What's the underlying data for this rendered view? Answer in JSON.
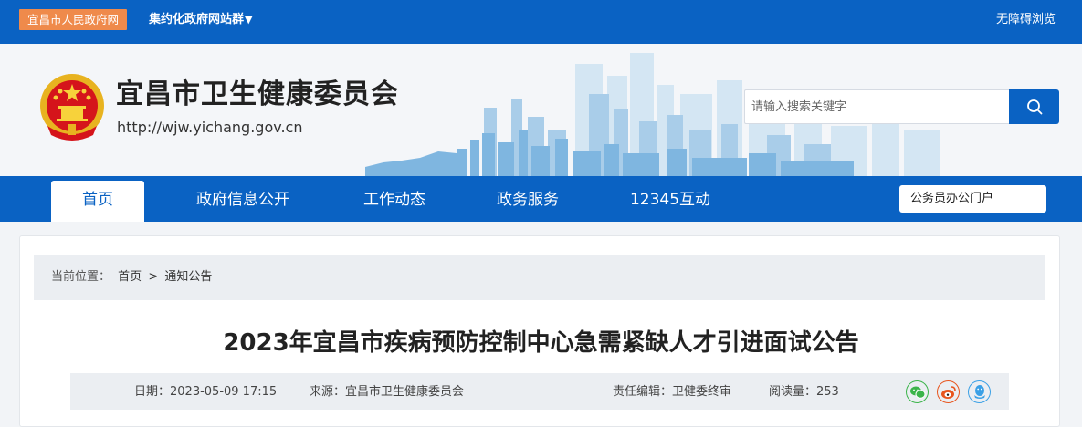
{
  "topbar": {
    "site_button": "宜昌市人民政府网",
    "cluster_label": "集约化政府网站群",
    "cluster_arrow": "▼",
    "accessibility": "无障碍浏览"
  },
  "header": {
    "title": "宜昌市卫生健康委员会",
    "url": "http://wjw.yichang.gov.cn",
    "search": {
      "placeholder": "请输入搜索关键字",
      "icon": "search-icon"
    }
  },
  "nav": {
    "items": [
      "首页",
      "政府信息公开",
      "工作动态",
      "政务服务",
      "12345互动"
    ],
    "active_index": 0,
    "portal": "公务员办公门户"
  },
  "breadcrumb": {
    "prefix": "当前位置：",
    "items": [
      "首页",
      "通知公告"
    ],
    "separator": ">"
  },
  "article": {
    "title": "2023年宜昌市疾病预防控制中心急需紧缺人才引进面试公告",
    "date": "日期：2023-05-09 17:15",
    "source": "来源：宜昌市卫生健康委员会",
    "editor": "责任编辑：卫健委终审",
    "views": "阅读量：253",
    "share_icons": [
      "wechat-icon",
      "weibo-icon",
      "qq-icon"
    ]
  },
  "colors": {
    "brand_blue": "#0a62c3",
    "orange": "#ef8a4b",
    "wechat_green": "#3bb44a",
    "weibo_orange": "#e8551e",
    "qq_blue": "#3aa0e6"
  }
}
